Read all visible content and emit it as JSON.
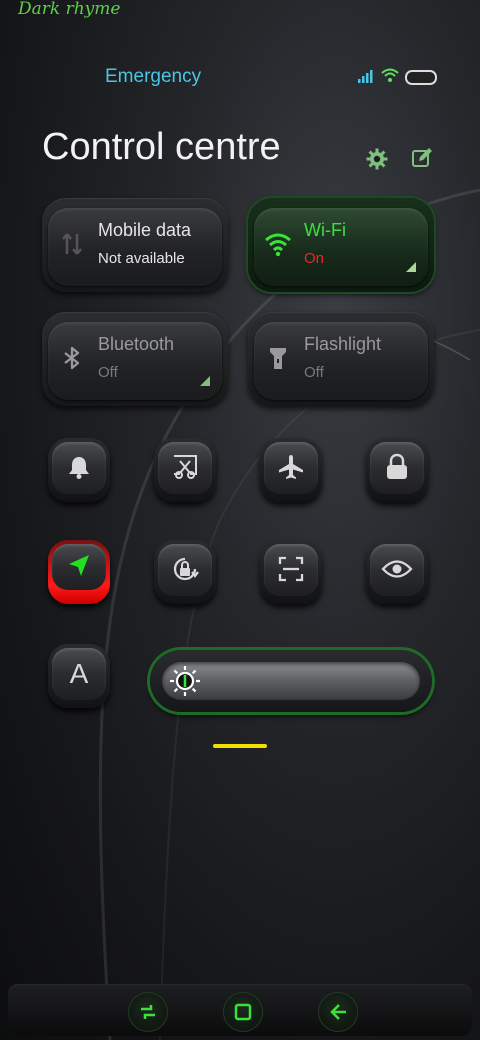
{
  "theme_name": "Dark rhyme",
  "status_bar": {
    "carrier_text": "Emergency",
    "signal_icon": "signal-bars-icon",
    "wifi_icon": "wifi-icon",
    "battery_icon": "battery-icon"
  },
  "header": {
    "title": "Control centre",
    "settings_icon": "gear-icon",
    "edit_icon": "edit-icon"
  },
  "tiles": [
    {
      "name": "Mobile data",
      "state": "Not available",
      "icon": "mobile-data-icon",
      "active": false
    },
    {
      "name": "Wi-Fi",
      "state": "On",
      "icon": "wifi-icon",
      "active": true
    },
    {
      "name": "Bluetooth",
      "state": "Off",
      "icon": "bluetooth-icon",
      "active": false
    },
    {
      "name": "Flashlight",
      "state": "Off",
      "icon": "flashlight-icon",
      "active": false
    }
  ],
  "toggles": [
    {
      "icon": "bell-icon"
    },
    {
      "icon": "screenshot-icon"
    },
    {
      "icon": "airplane-icon"
    },
    {
      "icon": "lock-icon"
    },
    {
      "icon": "location-icon",
      "active": true
    },
    {
      "icon": "rotation-lock-icon"
    },
    {
      "icon": "scan-icon"
    },
    {
      "icon": "eye-icon"
    },
    {
      "icon": "auto-brightness-icon",
      "label": "A"
    }
  ],
  "brightness": {
    "icon": "sun-icon",
    "level": 0.0
  },
  "navigation": {
    "buttons": [
      "recents-icon",
      "home-icon",
      "back-icon"
    ]
  },
  "colors": {
    "accent_green": "#3be23a",
    "status_cyan": "#49c6e5",
    "alert_red": "#ff1a1a",
    "pager_yellow": "#f0e000"
  }
}
